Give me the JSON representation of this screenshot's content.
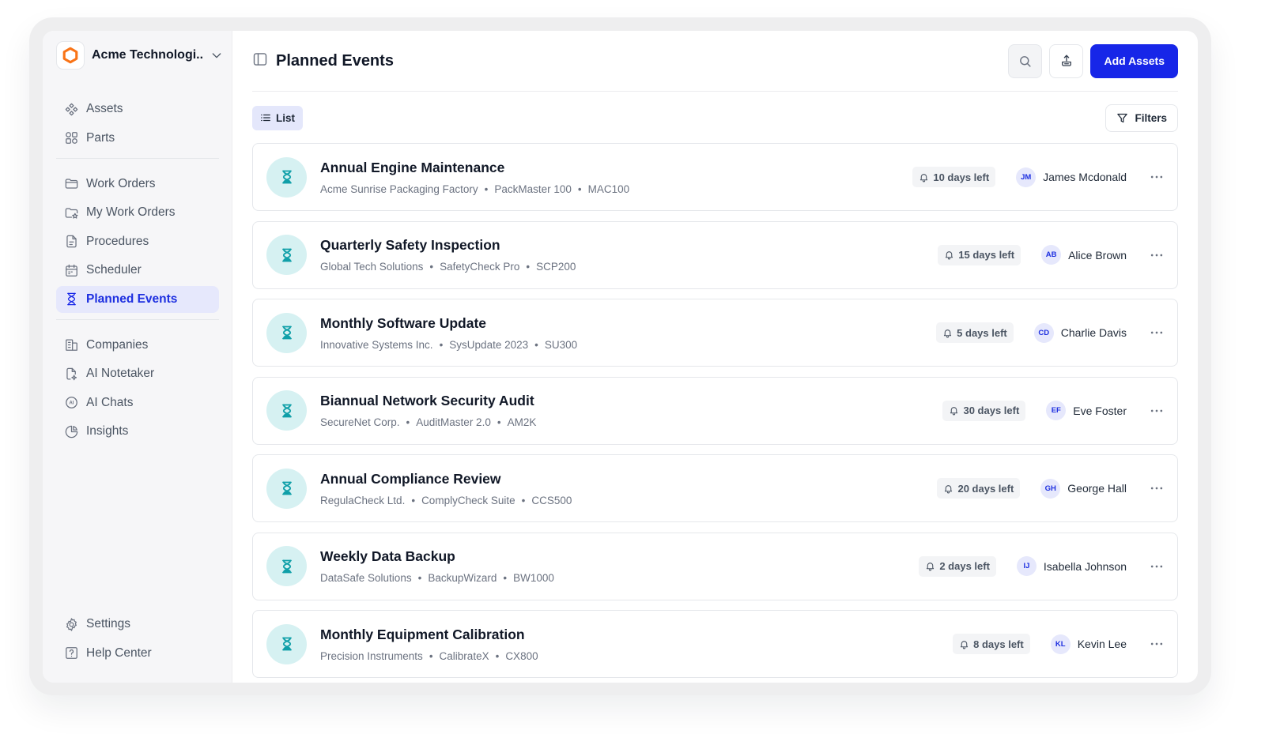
{
  "org": {
    "name": "Acme Technologi...",
    "logo_icon": "hexagon-logo",
    "accent": "#f97316"
  },
  "sidebar": {
    "groups": [
      [
        {
          "label": "Assets",
          "icon": "assets-icon"
        },
        {
          "label": "Parts",
          "icon": "parts-icon"
        }
      ],
      [
        {
          "label": "Work Orders",
          "icon": "folder-icon"
        },
        {
          "label": "My Work Orders",
          "icon": "folder-star-icon"
        },
        {
          "label": "Procedures",
          "icon": "document-icon"
        },
        {
          "label": "Scheduler",
          "icon": "calendar-icon"
        },
        {
          "label": "Planned Events",
          "icon": "hourglass-icon",
          "active": true
        }
      ],
      [
        {
          "label": "Companies",
          "icon": "building-icon"
        },
        {
          "label": "AI Notetaker",
          "icon": "ai-note-icon"
        },
        {
          "label": "AI Chats",
          "icon": "ai-chat-icon"
        },
        {
          "label": "Insights",
          "icon": "pie-chart-icon"
        }
      ]
    ],
    "bottom": [
      {
        "label": "Settings",
        "icon": "gear-icon"
      },
      {
        "label": "Help Center",
        "icon": "help-icon"
      }
    ]
  },
  "header": {
    "title": "Planned Events",
    "add_label": "Add Assets"
  },
  "toolbar": {
    "view_label": "List",
    "filters_label": "Filters"
  },
  "colors": {
    "primary": "#1726e8",
    "active_bg": "#e6e8fc",
    "event_icon_bg": "#d6f1f2",
    "event_icon": "#0f9fa8"
  },
  "events": [
    {
      "title": "Annual Engine Maintenance",
      "company": "Acme Sunrise Packaging Factory",
      "asset": "PackMaster 100",
      "code": "MAC100",
      "due": "10 days left",
      "initials": "JM",
      "assignee": "James Mcdonald"
    },
    {
      "title": "Quarterly Safety Inspection",
      "company": "Global Tech Solutions",
      "asset": "SafetyCheck Pro",
      "code": "SCP200",
      "due": "15 days left",
      "initials": "AB",
      "assignee": "Alice Brown"
    },
    {
      "title": "Monthly Software Update",
      "company": "Innovative Systems Inc.",
      "asset": "SysUpdate 2023",
      "code": "SU300",
      "due": "5 days left",
      "initials": "CD",
      "assignee": "Charlie Davis"
    },
    {
      "title": "Biannual Network Security Audit",
      "company": "SecureNet Corp.",
      "asset": "AuditMaster 2.0",
      "code": "AM2K",
      "due": "30 days left",
      "initials": "EF",
      "assignee": "Eve Foster"
    },
    {
      "title": "Annual Compliance Review",
      "company": "RegulaCheck Ltd.",
      "asset": "ComplyCheck Suite",
      "code": "CCS500",
      "due": "20 days left",
      "initials": "GH",
      "assignee": "George Hall"
    },
    {
      "title": "Weekly Data Backup",
      "company": "DataSafe Solutions",
      "asset": "BackupWizard",
      "code": "BW1000",
      "due": "2 days left",
      "initials": "IJ",
      "assignee": "Isabella Johnson"
    },
    {
      "title": "Monthly Equipment Calibration",
      "company": "Precision Instruments",
      "asset": "CalibrateX",
      "code": "CX800",
      "due": "8 days left",
      "initials": "KL",
      "assignee": "Kevin Lee"
    }
  ]
}
